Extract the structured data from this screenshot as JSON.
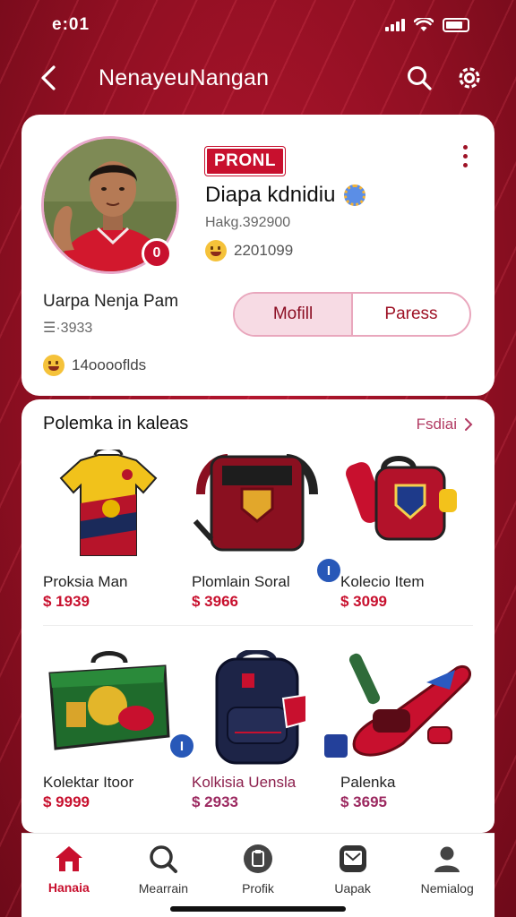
{
  "status": {
    "time": "e:01"
  },
  "appbar": {
    "title": "NenayeuNangan"
  },
  "profile": {
    "tag": "PRONL",
    "name": "Diapa kdnidiu",
    "handle": "Hakg.392900",
    "followers": "2201099",
    "full_name": "Uarpa Nenja Pam",
    "code": "☰·3933",
    "likes": "14ooooflds",
    "avatar_badge": "0",
    "segments": [
      "Mofill",
      "Paress"
    ]
  },
  "section": {
    "title": "Polemka in kaleas",
    "see_all": "Fsdiai"
  },
  "products": [
    {
      "name": "Proksia Man",
      "price": "$ 1939"
    },
    {
      "name": "Plomlain Soral",
      "price": "$ 3966",
      "badge": "I"
    },
    {
      "name": "Kolecio Item",
      "price": "$ 3099"
    },
    {
      "name": "Kolektar Itoor",
      "price": "$ 9999",
      "badge": "I"
    },
    {
      "name": "Kolkisia Uensla",
      "price": "$ 2933"
    },
    {
      "name": "Palenka",
      "price": "$ 3695"
    }
  ],
  "nav": [
    {
      "label": "Hanaia",
      "icon": "home-icon",
      "active": true
    },
    {
      "label": "Mearrain",
      "icon": "search-icon"
    },
    {
      "label": "Profik",
      "icon": "clipboard-icon"
    },
    {
      "label": "Uapak",
      "icon": "message-icon"
    },
    {
      "label": "Nemialog",
      "icon": "user-icon"
    }
  ],
  "colors": {
    "primary": "#c8102e",
    "background": "#9e1226",
    "accent_pink": "#f7dbe4"
  }
}
